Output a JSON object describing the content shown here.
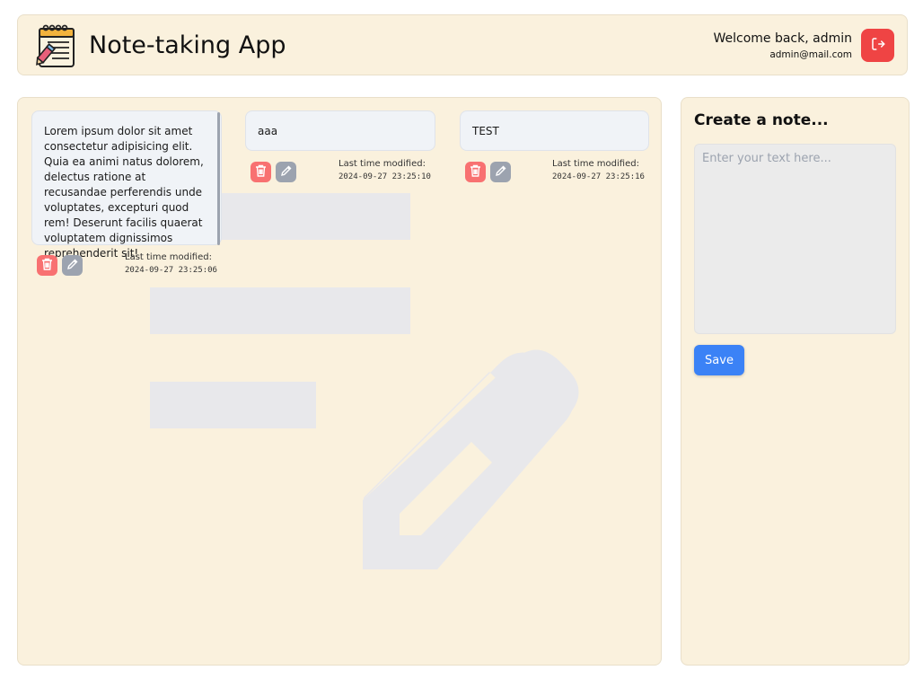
{
  "header": {
    "app_title": "Note-taking App",
    "welcome_text": "Welcome back, admin",
    "email": "admin@mail.com",
    "logo_icon": "notepad-pencil-icon",
    "logout_icon": "logout-icon"
  },
  "notes": [
    {
      "text": "Lorem ipsum dolor sit amet consectetur adipisicing elit. Quia ea animi natus dolorem, delectus ratione at recusandae perferendis unde voluptates, excepturi quod rem! Deserunt facilis quaerat voluptatem dignissimos reprehenderit sit!",
      "modified_label": "Last time modified:",
      "modified_time": "2024-09-27 23:25:06"
    },
    {
      "text": "aaa",
      "modified_label": "Last time modified:",
      "modified_time": "2024-09-27 23:25:10"
    },
    {
      "text": "TEST",
      "modified_label": "Last time modified:",
      "modified_time": "2024-09-27 23:25:16"
    }
  ],
  "create": {
    "title": "Create a note...",
    "placeholder": "Enter your text here...",
    "save_label": "Save"
  },
  "colors": {
    "panel_bg": "#faf1dd",
    "delete": "#f87171",
    "edit": "#9ca3af",
    "save": "#3b82f6",
    "logout": "#ef4444"
  }
}
